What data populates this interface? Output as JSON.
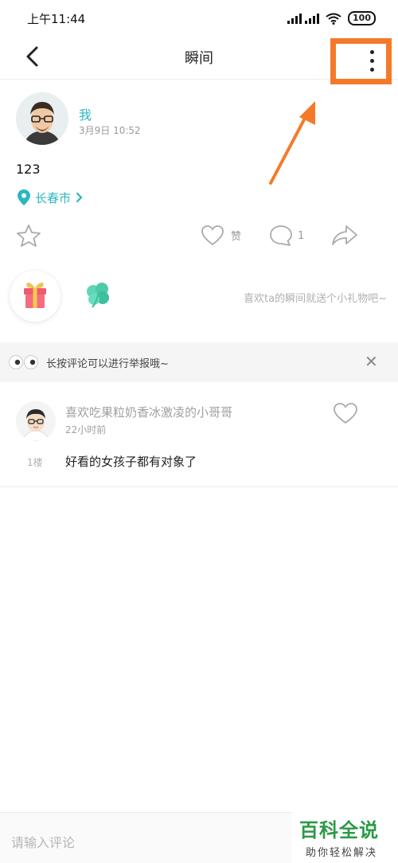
{
  "status_bar": {
    "time": "上午11:44",
    "battery": "100"
  },
  "nav": {
    "title": "瞬间"
  },
  "colors": {
    "accent": "#2bb7bf",
    "highlight_box": "#f47a2a",
    "watermark_green": "#2a9a46"
  },
  "post": {
    "author": "我",
    "time": "3月9日 10:52",
    "text": "123",
    "location": "长春市",
    "like_label": "赞",
    "comment_count": "1"
  },
  "gift": {
    "hint": "喜欢ta的瞬间就送个小礼物吧~"
  },
  "notice": {
    "text": "长按评论可以进行举报哦~"
  },
  "comments": [
    {
      "name": "喜欢吃果粒奶香冰激凌的小哥哥",
      "time": "22小时前",
      "floor": "1楼",
      "text": "好看的女孩子都有对象了"
    }
  ],
  "input": {
    "placeholder": "请输入评论"
  },
  "watermark": {
    "title": "百科全说",
    "subtitle": "助你轻松解决"
  },
  "icons": [
    "back-icon",
    "more-icon",
    "location-pin-icon",
    "star-icon",
    "heart-icon",
    "comment-bubble-icon",
    "share-icon",
    "gift-icon",
    "clover-icon",
    "eyes-icon",
    "close-icon"
  ]
}
